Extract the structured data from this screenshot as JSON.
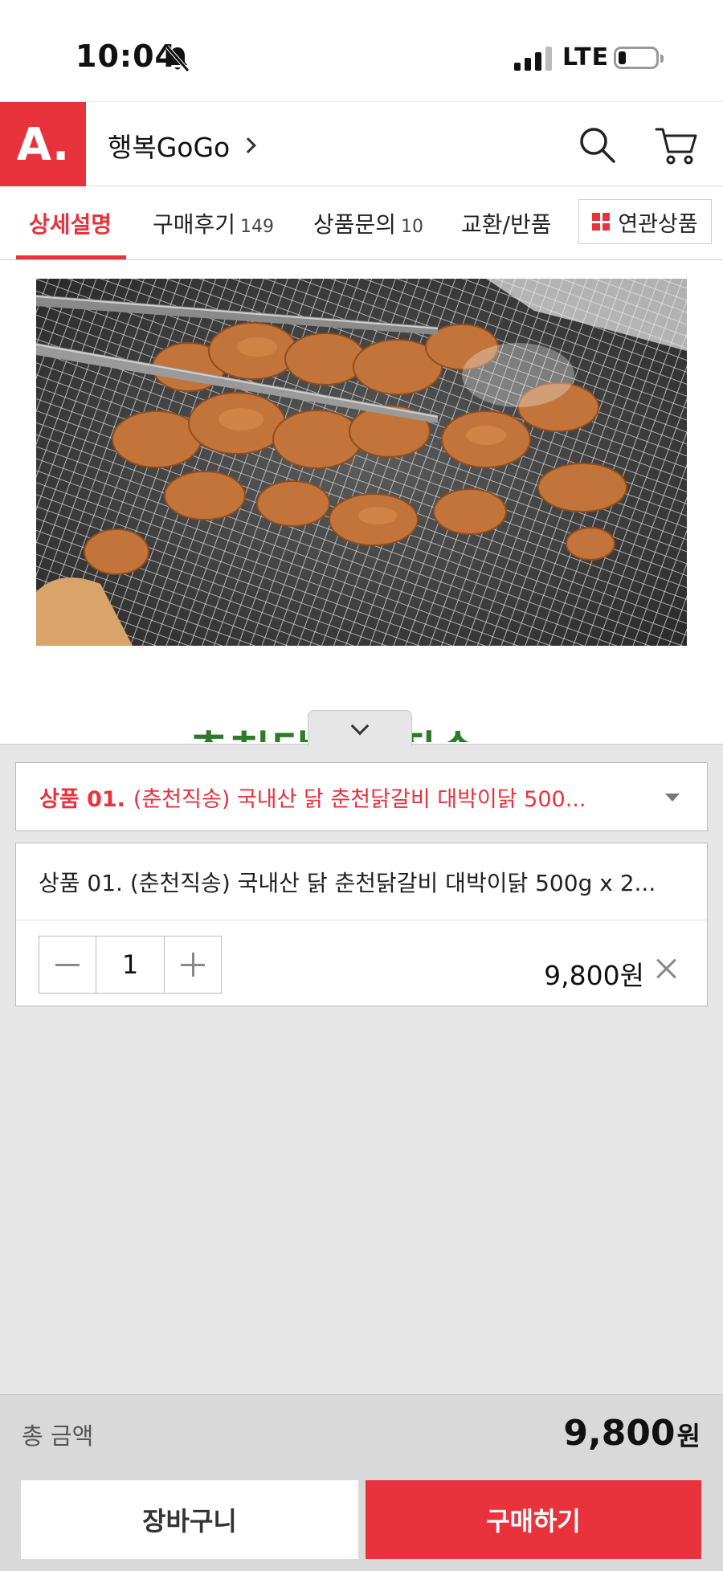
{
  "status_bar": {
    "time": "10:04",
    "network": "LTE",
    "icons": [
      "bell-off-icon",
      "signal-icon",
      "battery-icon"
    ]
  },
  "header": {
    "logo_text": "A.",
    "store_name": "행복GoGo",
    "brand_color": "#e8323c",
    "icons": [
      "search-icon",
      "cart-icon"
    ]
  },
  "tabs": {
    "items": [
      {
        "label": "상세설명",
        "count": ""
      },
      {
        "label": "구매후기",
        "count": "149"
      },
      {
        "label": "상품문의",
        "count": "10"
      },
      {
        "label": "교환/반품",
        "count": ""
      }
    ],
    "active_index": 0,
    "related_button": "연관상품"
  },
  "content": {
    "peek_text": "춘천닭갈비직송"
  },
  "options": {
    "select_prefix": "상품 01.",
    "select_value": "(춘천직송) 국내산 닭 춘천닭갈비 대박이닭 500...",
    "selected_item_name": "상품 01. (춘천직송) 국내산 닭 춘천닭갈비 대박이닭 500g x 2...",
    "quantity": "1",
    "line_price": "9,800원"
  },
  "footer": {
    "total_label": "총 금액",
    "total_amount": "9,800",
    "total_unit": "원",
    "cart_button": "장바구니",
    "buy_button": "구매하기"
  }
}
